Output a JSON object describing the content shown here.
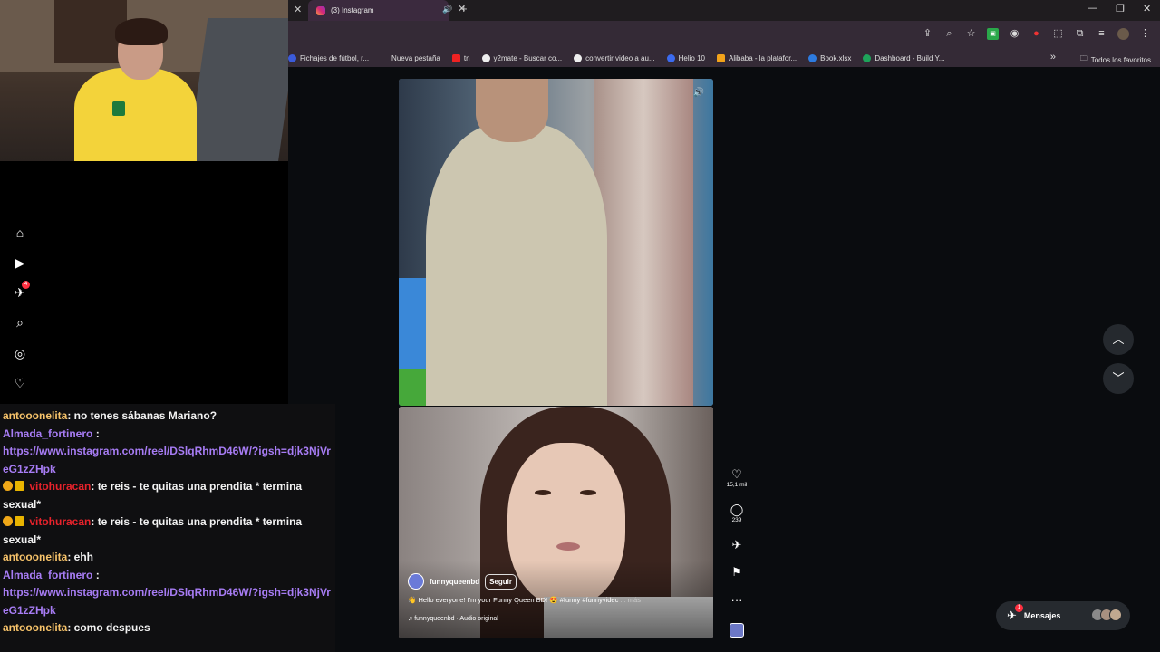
{
  "browser": {
    "tab_title": "(3) Instagram",
    "bookmarks": [
      {
        "label": "Fichajes de fútbol, r...",
        "color": "#3b5bdb"
      },
      {
        "label": "Nueva pestaña",
        "color": "transparent"
      },
      {
        "label": "tn",
        "color": "#e22"
      },
      {
        "label": "y2mate - Buscar co...",
        "color": "#eee"
      },
      {
        "label": "convertir video a au...",
        "color": "#eee"
      },
      {
        "label": "Helio 10",
        "color": "#3b6bf0"
      },
      {
        "label": "Alibaba - la platafor...",
        "color": "#f2a31a"
      },
      {
        "label": "Book.xlsx",
        "color": "#2d7be0"
      },
      {
        "label": "Dashboard - Build Y...",
        "color": "#1ea35a"
      }
    ],
    "bookmarks_end_label": "Todos los favoritos"
  },
  "ig_nav": {
    "notifications_badge": "4"
  },
  "chat": {
    "messages": [
      {
        "user": "antooonelita",
        "user_color": "orange",
        "text": ": no tenes sábanas Mariano?"
      },
      {
        "user": "Almada_fortinero",
        "user_color": "purple",
        "text": ":",
        "link": "https://www.instagram.com/reel/DSlqRhmD46W/?igsh=djk3NjVreG1zZHpk"
      },
      {
        "user": "vitohuracan",
        "user_color": "red",
        "text": ": te reis - te quitas una prendita * termina sexual*"
      },
      {
        "user": "vitohuracan",
        "user_color": "red",
        "text": ": te reis - te quitas una prendita * termina sexual*"
      },
      {
        "user": "antooonelita",
        "user_color": "orange",
        "text": ": ehh"
      },
      {
        "user": "Almada_fortinero",
        "user_color": "purple",
        "text": ":",
        "link": "https://www.instagram.com/reel/DSlqRhmD46W/?igsh=djk3NjVreG1zZHpk"
      },
      {
        "user": "antooonelita",
        "user_color": "orange",
        "text": ": como despues"
      }
    ]
  },
  "reel": {
    "account": "funnyqueenbd",
    "follow_label": "Seguir",
    "caption": "Hello everyone! I'm your Funny Queen BD!",
    "hashtags": "#funny #funnyvidec",
    "more_label": "... más",
    "audio": "funnyqueenbd · Audio original",
    "likes": "15,1 mil",
    "comments": "239"
  },
  "messages_pill": {
    "label": "Mensajes",
    "badge": "1"
  },
  "colors": {
    "chat_orange": "#f7c36a",
    "chat_purple": "#a77cf4",
    "chat_red": "#e6222b",
    "ig_red": "#ff3040"
  }
}
